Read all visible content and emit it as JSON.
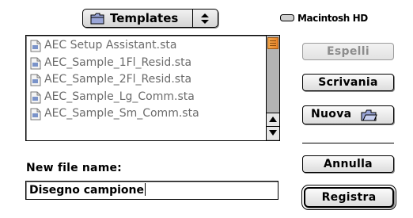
{
  "folder_popup": {
    "label": "Templates",
    "icon": "folder-icon"
  },
  "disk": {
    "name": "Macintosh HD",
    "icon": "hard-disk-icon"
  },
  "file_list": {
    "items": [
      {
        "name": "AEC Setup Assistant.sta",
        "dim": true
      },
      {
        "name": "AEC_Sample_1Fl_Resid.sta",
        "dim": true
      },
      {
        "name": "AEC_Sample_2Fl_Resid.sta",
        "dim": true
      },
      {
        "name": "AEC_Sample_Lg_Comm.sta",
        "dim": true
      },
      {
        "name": "AEC_Sample_Sm_Comm.sta",
        "dim": true
      }
    ],
    "scroll_thumb_color": "#f09a3c"
  },
  "buttons": {
    "espelli": "Espelli",
    "scrivania": "Scrivania",
    "nuova": "Nuova",
    "annulla": "Annulla",
    "registra": "Registra"
  },
  "new_file": {
    "label": "New file name:",
    "value": "Disegno campione"
  }
}
